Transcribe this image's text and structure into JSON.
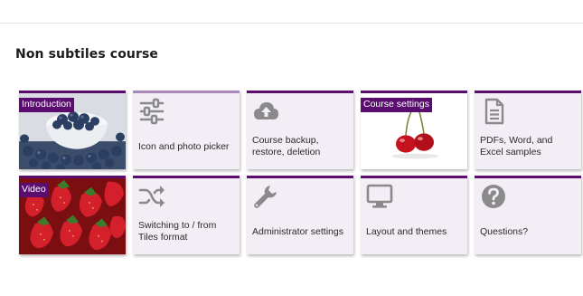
{
  "course": {
    "title": "Non subtiles course"
  },
  "tiles": [
    {
      "label": "Introduction",
      "icon": "blueberries-photo"
    },
    {
      "label": "Icon and photo picker",
      "icon": "sliders-icon"
    },
    {
      "label": "Course backup, restore, deletion",
      "icon": "cloud-upload-icon"
    },
    {
      "label": "Course settings",
      "icon": "cherries-photo"
    },
    {
      "label": "PDFs, Word, and Excel samples",
      "icon": "file-text-icon"
    },
    {
      "label": "Video",
      "icon": "strawberries-photo"
    },
    {
      "label": "Switching to / from Tiles format",
      "icon": "shuffle-icon"
    },
    {
      "label": "Administrator settings",
      "icon": "wrench-icon"
    },
    {
      "label": "Layout and themes",
      "icon": "desktop-icon"
    },
    {
      "label": "Questions?",
      "icon": "question-circle-icon"
    }
  ],
  "colors": {
    "accent": "#5a0d6f",
    "tile_background": "#f3eef5",
    "icon_gray": "#8a8a8a"
  }
}
